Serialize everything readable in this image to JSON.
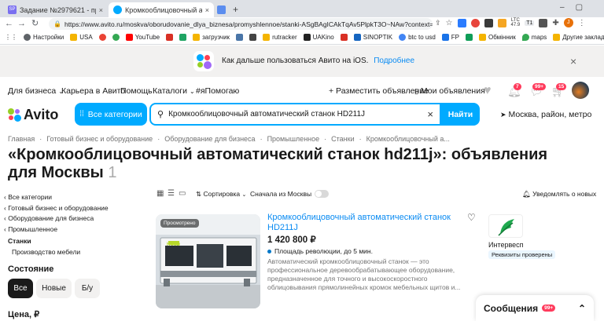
{
  "browser": {
    "tabs": [
      {
        "label": "Задание №2979621 - просмотр з",
        "close": "×"
      },
      {
        "label": "Кромкооблицовочный автомати",
        "close": "×"
      },
      {
        "label": "",
        "close": "×"
      }
    ],
    "new_tab": "+",
    "url": "https://www.avito.ru/moskva/oborudovanie_dlya_biznesa/promyshlennoe/stanki-ASgBAgICAkTqAv5PlpkT3O~NAw?context=H4sI...",
    "ext_ltc": "LTC",
    "ext_ltc_val": "47.9",
    "ext_t1": "T1",
    "ext_badge": "1",
    "profile_letter": "J",
    "bookmarks": [
      "Настройки",
      "USA",
      "",
      "YouTube",
      "",
      "",
      "загрузчик",
      "",
      "",
      "rutracker",
      "UAKino",
      "",
      "SINOPTIK",
      "btc to usd",
      "FP",
      "",
      "Обмінник",
      "maps"
    ],
    "other_bookmarks": "Другие закладки"
  },
  "banner": {
    "text": "Как дальше пользоваться Авито на iOS.",
    "link": "Подробнее",
    "close": "×"
  },
  "topnav": {
    "business": "Для бизнеса",
    "career": "Карьера в Авито",
    "help": "Помощь",
    "catalogs": "Каталоги",
    "help_tag": "#яПомогаю",
    "post_ad": "+ Разместить объявление",
    "my_ads": "Мои объявления",
    "notif_count": "7",
    "msg_count": "99+",
    "cart_count": "15"
  },
  "header": {
    "logo": "Avito",
    "all_categories": "Все категории",
    "search_value": "Кромкооблицовочный автоматический станок HD211J",
    "find": "Найти",
    "location": "Москва, район, метро"
  },
  "breadcrumbs": [
    "Главная",
    "Готовый бизнес и оборудование",
    "Оборудование для бизнеса",
    "Промышленное",
    "Станки",
    "Кромкооблицовочный а..."
  ],
  "page": {
    "title": "«Кромкооблицовочный автоматический станок hd211j»: объявления для Москвы",
    "count": "1"
  },
  "sidebar": {
    "links": [
      "Все категории",
      "Готовый бизнес и оборудование",
      "Оборудование для бизнеса",
      "Промышленное"
    ],
    "current": "Станки",
    "sub": "Производство мебели",
    "condition_title": "Состояние",
    "condition_options": [
      "Все",
      "Новые",
      "Б/у"
    ],
    "price_title": "Цена, ₽"
  },
  "toolbar": {
    "sort": "Сортировка",
    "moscow_first": "Сначала из Москвы",
    "notify": "Уведомлять о новых"
  },
  "listing": {
    "seen_badge": "Просмотрено",
    "title": "Кромкооблицовочный автоматический станок HD211J",
    "price": "1 420 800 ₽",
    "location": "Площадь революции, до 5 мин.",
    "description": "Автоматический кромкооблицовочный станок — это профессиональное деревообрабатывающее оборудование, предназначенное для точного и высокоскоростного облицовывания прямолинейных кромок мебельных щитов и...",
    "image_label": "HOLD"
  },
  "seller": {
    "name": "Интервесп",
    "badge": "Реквизиты проверены"
  },
  "messages": {
    "label": "Сообщения",
    "count": "99+"
  },
  "colors": {
    "accent": "#00aaff",
    "link": "#0a8bf2",
    "badge_red": "#ff3b5c",
    "seller_badge_bg": "#eaf6ff"
  }
}
